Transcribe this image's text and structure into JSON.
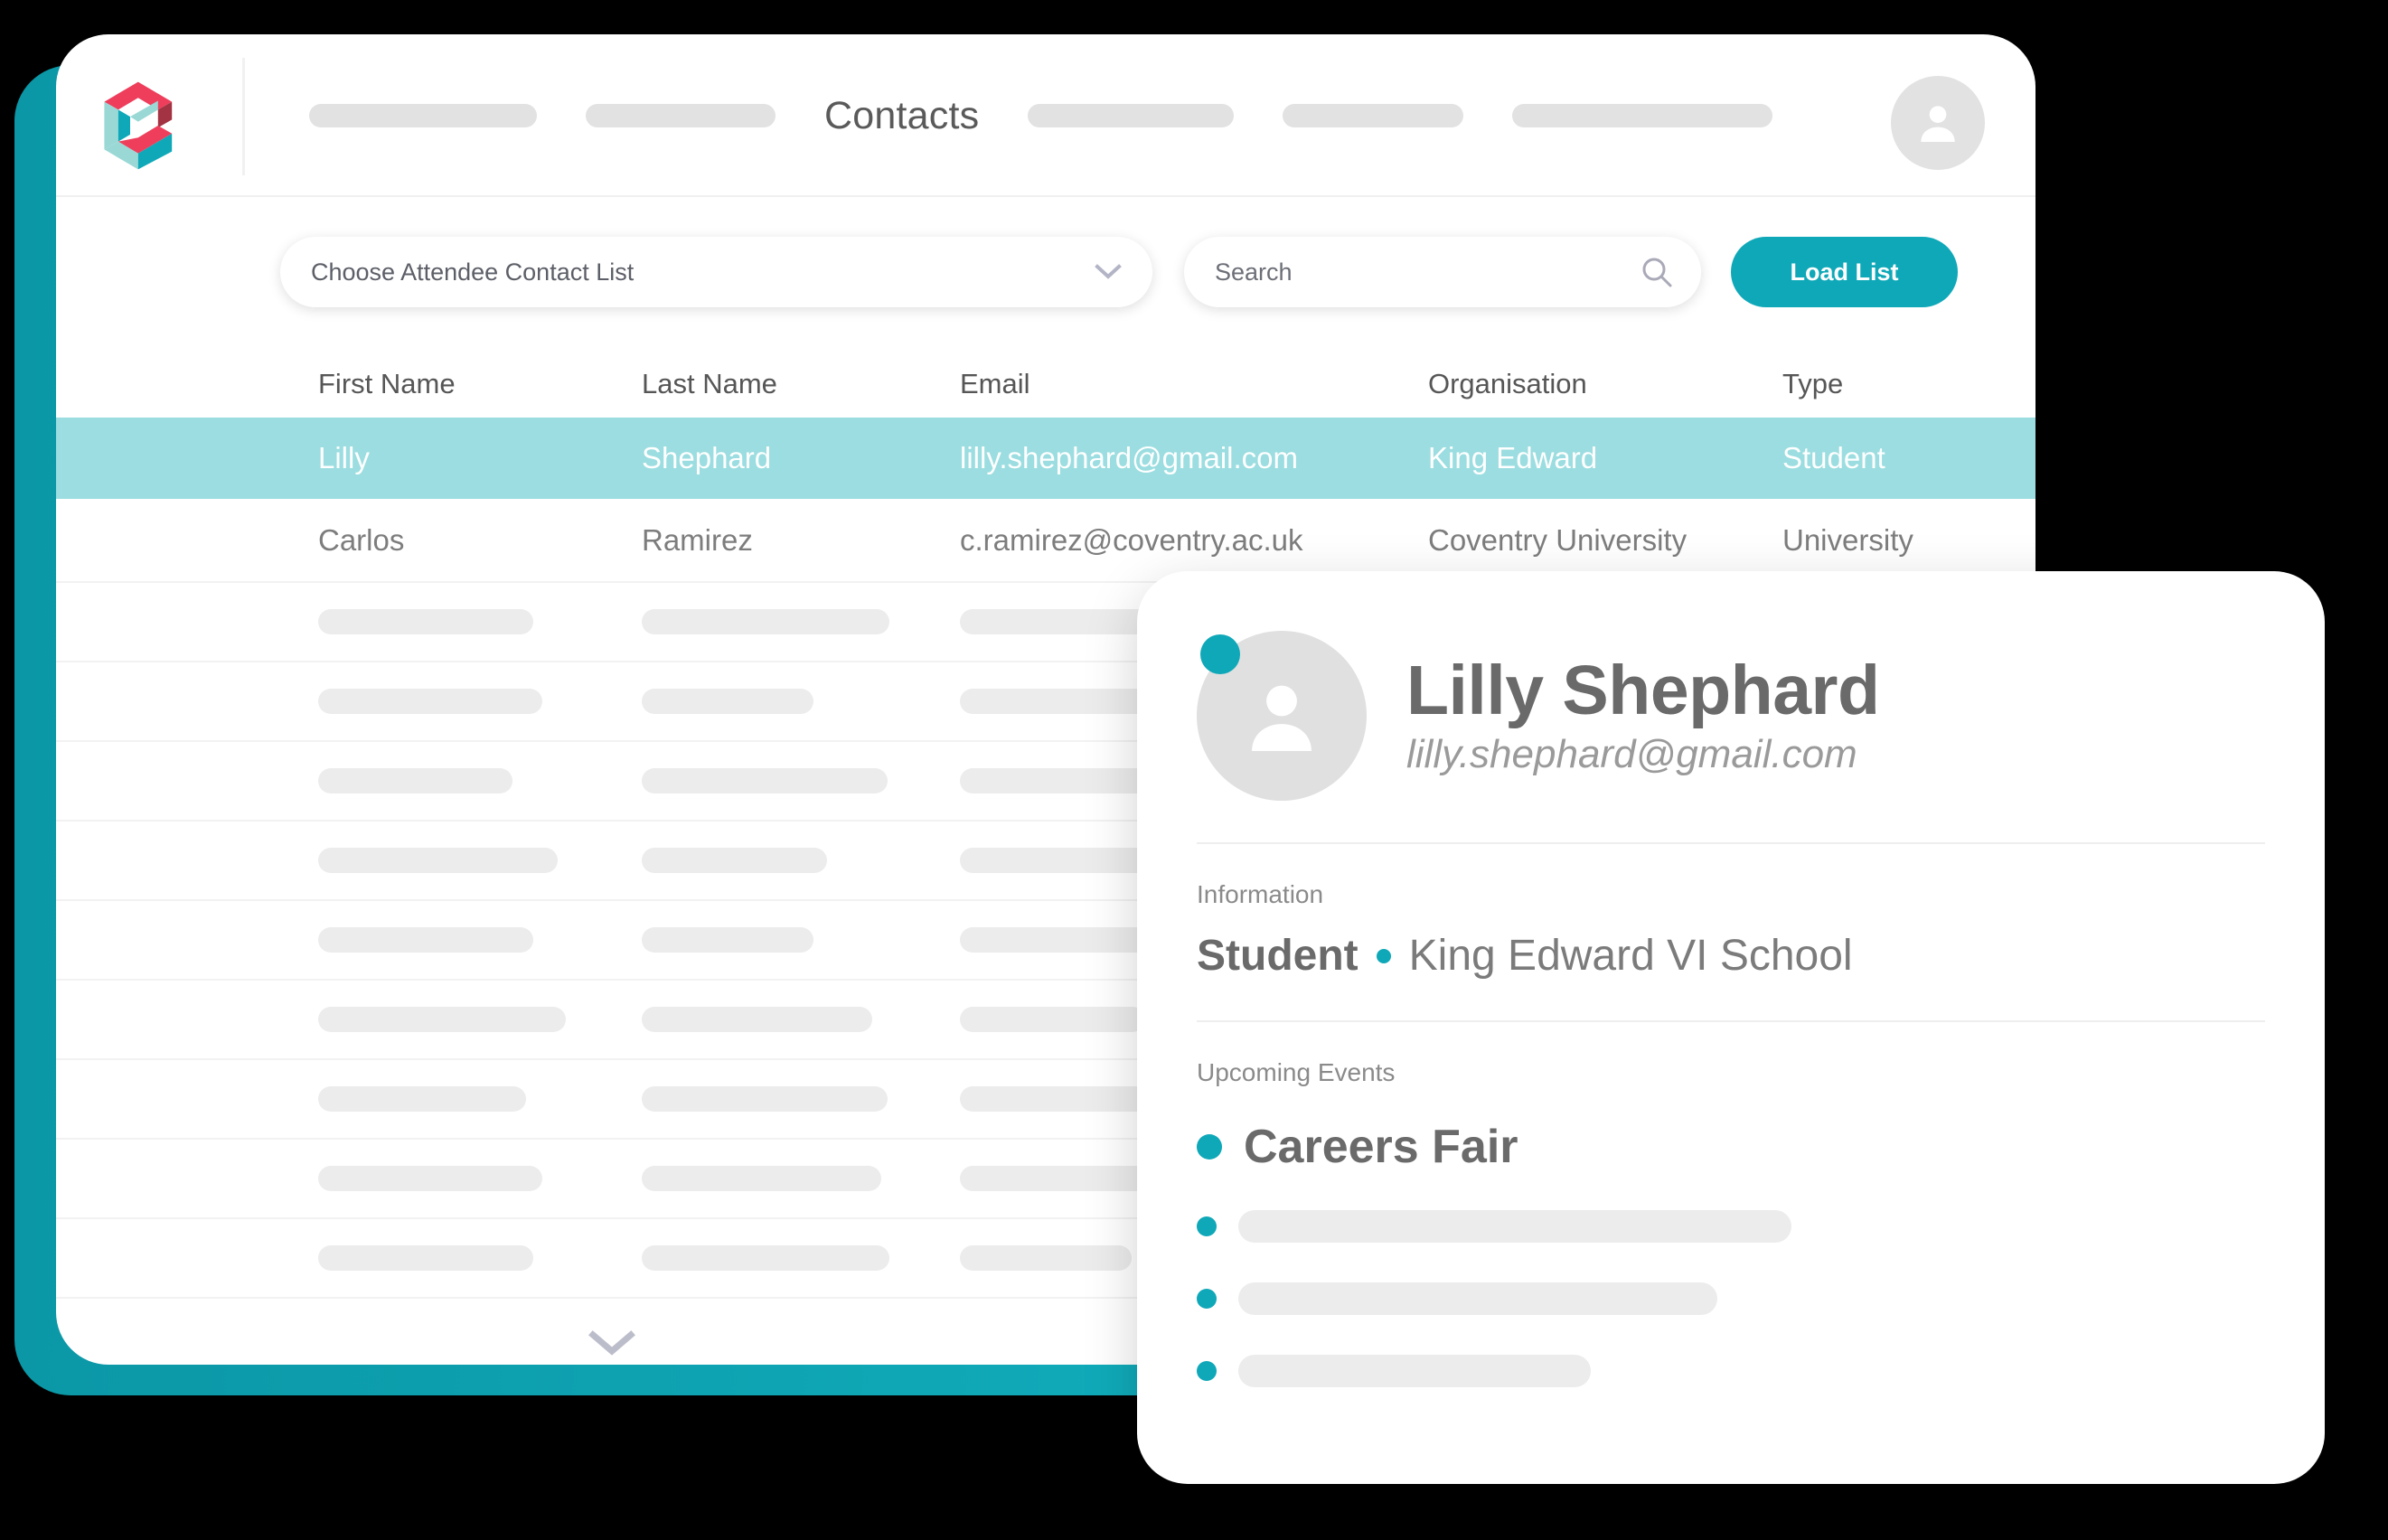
{
  "theme": {
    "accent_teal": "#0fa8b8",
    "selected_row_teal": "#9bdde0",
    "back_panel_teal": "#10aab9",
    "logo_red": "#ee3e5c",
    "logo_light_teal": "#9ad8d6",
    "logo_dark_teal": "#0fa8b8",
    "background": "#000000",
    "skeleton_gray": "#ececec"
  },
  "navbar": {
    "logo_name": "app-logo",
    "title": "Contacts",
    "placeholder_items": [
      "",
      "",
      "",
      ""
    ],
    "avatar_label": ""
  },
  "toolbar": {
    "select_label": "Choose Attendee Contact List",
    "search_placeholder": "Search",
    "search_value": "",
    "load_list_label": "Load List"
  },
  "table": {
    "columns": [
      "First Name",
      "Last Name",
      "Email",
      "Organisation",
      "Type"
    ],
    "rows": [
      {
        "first_name": "Lilly",
        "last_name": "Shephard",
        "email": "lilly.shephard@gmail.com",
        "organisation": "King Edward",
        "type": "Student",
        "selected": true
      },
      {
        "first_name": "Carlos",
        "last_name": "Ramirez",
        "email": "c.ramirez@coventry.ac.uk",
        "organisation": "Coventry University",
        "type": "University",
        "selected": false
      }
    ],
    "skeleton_row_count": 9,
    "more_icon": "chevron-down-icon"
  },
  "detail_card": {
    "status_indicator": "online",
    "name": "Lilly Shephard",
    "email": "lilly.shephard@gmail.com",
    "information_label": "Information",
    "info_type": "Student",
    "info_separator": "•",
    "info_organisation": "King Edward VI School",
    "events_label": "Upcoming Events",
    "primary_event": "Careers Fair",
    "placeholder_event_count": 3
  }
}
